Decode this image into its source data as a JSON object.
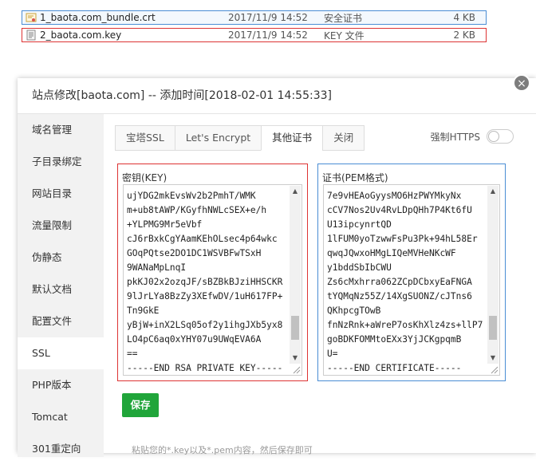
{
  "files": [
    {
      "name": "1_baota.com_bundle.crt",
      "date": "2017/11/9 14:52",
      "type": "安全证书",
      "size": "4 KB",
      "icon": "certificate-file-icon"
    },
    {
      "name": "2_baota.com.key",
      "date": "2017/11/9 14:52",
      "type": "KEY 文件",
      "size": "2 KB",
      "icon": "key-file-icon"
    }
  ],
  "dialog": {
    "title": "站点修改[baota.com] -- 添加时间[2018-02-01 14:55:33]",
    "close_label": "×",
    "sidebar": [
      {
        "label": "域名管理"
      },
      {
        "label": "子目录绑定"
      },
      {
        "label": "网站目录"
      },
      {
        "label": "流量限制"
      },
      {
        "label": "伪静态"
      },
      {
        "label": "默认文档"
      },
      {
        "label": "配置文件"
      },
      {
        "label": "SSL",
        "active": true
      },
      {
        "label": "PHP版本"
      },
      {
        "label": "Tomcat"
      },
      {
        "label": "301重定向"
      }
    ],
    "tabs": [
      {
        "label": "宝塔SSL"
      },
      {
        "label": "Let's Encrypt"
      },
      {
        "label": "其他证书",
        "active": true
      },
      {
        "label": "关闭"
      }
    ],
    "force_https_label": "强制HTTPS",
    "force_https_on": false,
    "key_label": "密钥(KEY)",
    "cert_label": "证书(PEM格式)",
    "key_lines": [
      "ujYDG2mkEvsWv2b2PmhT/WMK",
      "m+ub8tAWP/KGyfhNWLcSEX+e/h",
      "+YLPMG9Mr5eVbf",
      "cJ6rBxkCgYAamKEhOLsec4p64wkc",
      "GOqPQtse2DO1DC1WSVBFwTSxH",
      "9WANaMpLnqI",
      "pkKJ02x2ozqJF/sBZBkBJziHHSCKR",
      "9lJrLYa8BzZy3XEfwDV/1uH617FP+",
      "Tn9GkE",
      "yBjW+inX2LSq05of2y1ihgJXb5yx8",
      "LO4pC6aq0xYHY07u9UWqEVA6A",
      "==",
      "-----END RSA PRIVATE KEY-----"
    ],
    "cert_lines": [
      "7e9vHEAoGyysMO6HzPWYMkyNx",
      "cCV7Nos2Uv4RvLDpQHh7P4Kt6fU",
      "U13ipcynrtQD",
      "1lFUM0yoTzwwFsPu3Pk+94hL58Er",
      "qwqJQwxoHMgLIQeMVHeNKcWF",
      "y1bddSbIbCWU",
      "Zs6cMxhrra062ZCpDCbxyEaFNGA",
      "tYQMqNz55Z/14XgSUONZ/cJTns6",
      "QKhpcgTOwB",
      "fnNzRnk+aWreP7osKhXlz4zs+llP7",
      "goBDKFOMMtoEXx3YjJCKgpqmB",
      "U=",
      "-----END CERTIFICATE-----"
    ],
    "key_scroll_fraction": 0.9,
    "cert_scroll_fraction": 0.9,
    "save_label": "保存",
    "hint_text": "粘贴您的*.key以及*.pem内容，然后保存即可"
  },
  "colors": {
    "accent_green": "#20a53a",
    "selection_blue": "#4a8dd4",
    "highlight_red": "#d33"
  }
}
